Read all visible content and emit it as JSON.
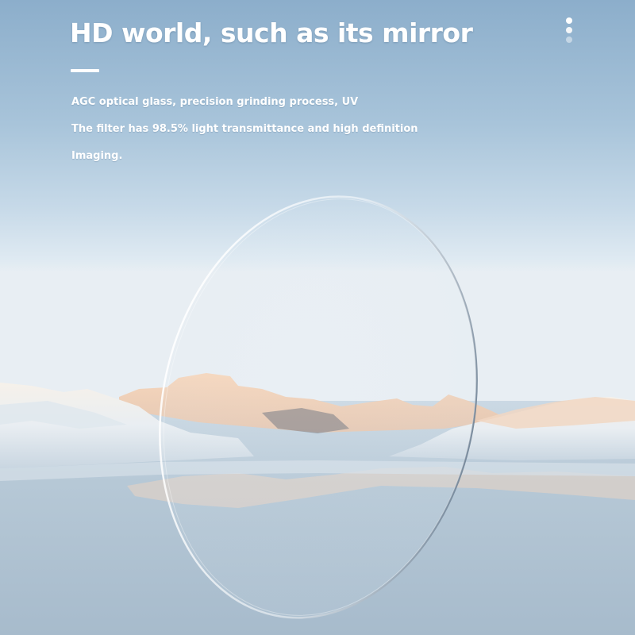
{
  "headline": "HD world, such as its mirror",
  "description_lines": [
    "AGC optical glass, precision grinding process, UV",
    "The filter has 98.5% light transmittance and high definition",
    "Imaging."
  ],
  "carousel": {
    "total": 3,
    "active": 1
  },
  "colors": {
    "sky_top": "#8fb1ce",
    "sky_horizon": "#dfeaf2",
    "ice": "#eef0f2",
    "sunlit_ice": "#f2d2ba",
    "text": "#ffffff"
  },
  "image": {
    "subject": "lens-filter-over-frozen-lake"
  }
}
